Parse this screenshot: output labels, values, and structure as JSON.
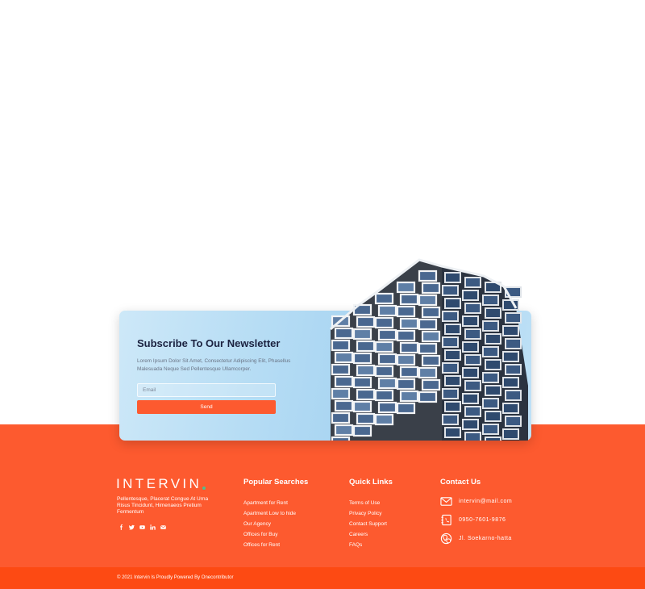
{
  "newsletter": {
    "title": "Subscribe To Our Newsletter",
    "description": "Lorem Ipsum Dolor Sit Amet, Consectetur Adipiscing Elit, Phasellus Malesuada Neque Sed Pellentesque Ullamcorper.",
    "email_placeholder": "Email",
    "send_label": "Send"
  },
  "brand": {
    "logo": "INTERVIN",
    "tagline": "Pellentesque, Placerat Congue At Urna Risus Tincidunt, Himenaeos Pretium Fermentum",
    "social_icons": [
      "facebook-icon",
      "twitter-icon",
      "youtube-icon",
      "linkedin-icon",
      "mail-icon"
    ]
  },
  "popular_searches": {
    "title": "Popular Searches",
    "links": [
      "Apartment for Rent",
      "Apartment Low to hide",
      "Our Agency",
      "Offices for Buy",
      "Offices for Rent"
    ]
  },
  "quick_links": {
    "title": "Quick Links",
    "links": [
      "Terms of Use",
      "Privacy Policy",
      "Contact Support",
      "Careers",
      "FAQs"
    ]
  },
  "contact": {
    "title": "Contact Us",
    "email": "intervin@mail.com",
    "phone": "0950-7601-9876",
    "address": "Jl. Soekarno-hatta"
  },
  "copyright": "© 2021 Intervin Is Proudly Powered By Onecontributor",
  "colors": {
    "accent": "#fd5a2f",
    "footer_bottom": "#fd4a13",
    "heading": "#1b2240",
    "logo_dot": "#4fbf8f"
  }
}
